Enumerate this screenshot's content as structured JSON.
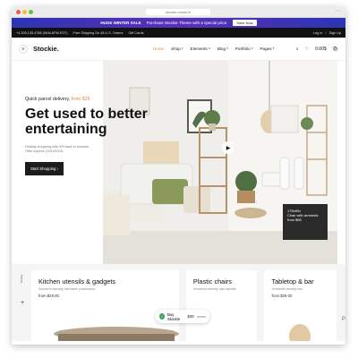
{
  "browser": {
    "url": "stockie.colabr.io"
  },
  "promo": {
    "text": "HUGE WINTER SALE",
    "detail": "Purchase Stockie Theme with a special price.",
    "button": "Save Now"
  },
  "topbar": {
    "phone": "+4.305.135.4788 (9AM-6PM EST)",
    "shipping": "Free Shipping On All U.S. Orders",
    "gift": "Gift Cards",
    "login": "Log In",
    "divider": "/",
    "signup": "Sign Up"
  },
  "nav": {
    "logo": "Stockie.",
    "menu": [
      {
        "label": "Home"
      },
      {
        "label": "Shop ᵞ"
      },
      {
        "label": "Elements ⁶"
      },
      {
        "label": "Blog ²"
      },
      {
        "label": "Portfolio ᵛ"
      },
      {
        "label": "Pages ³"
      }
    ],
    "cart_total": "0.00$"
  },
  "hero": {
    "kicker_prefix": "Quick parcel delivery, ",
    "kicker_highlight": "from $25",
    "headline": "Get used to better entertaining",
    "sub_line1": "Holiday shopping with 3% back in rewards.",
    "sub_line2": "Offer expires 12/31/2018.",
    "cta": "Start Shopping",
    "offer_size": "175x90x",
    "offer_desc": "Chair with armrests",
    "offer_price": "from $65"
  },
  "cards_side_label": "Home",
  "cards": [
    {
      "title": "Kitchen utensils & gadgets",
      "sub": "Sonderful density has taken possession",
      "price": "from $29.00"
    },
    {
      "title": "Plastic chairs",
      "sub": "Sonderful density has capsillic",
      "price": ""
    },
    {
      "title": "Tabletop & bar",
      "sub": "Sonderful density has",
      "price": "from $29.00"
    }
  ],
  "buy": {
    "label": "Buy Stockie",
    "price": "$39"
  },
  "colors": {
    "accent": "#d58c4f",
    "promo": "#2b35b5",
    "dark": "#1c1c1c",
    "buy": "#3aa55c"
  }
}
